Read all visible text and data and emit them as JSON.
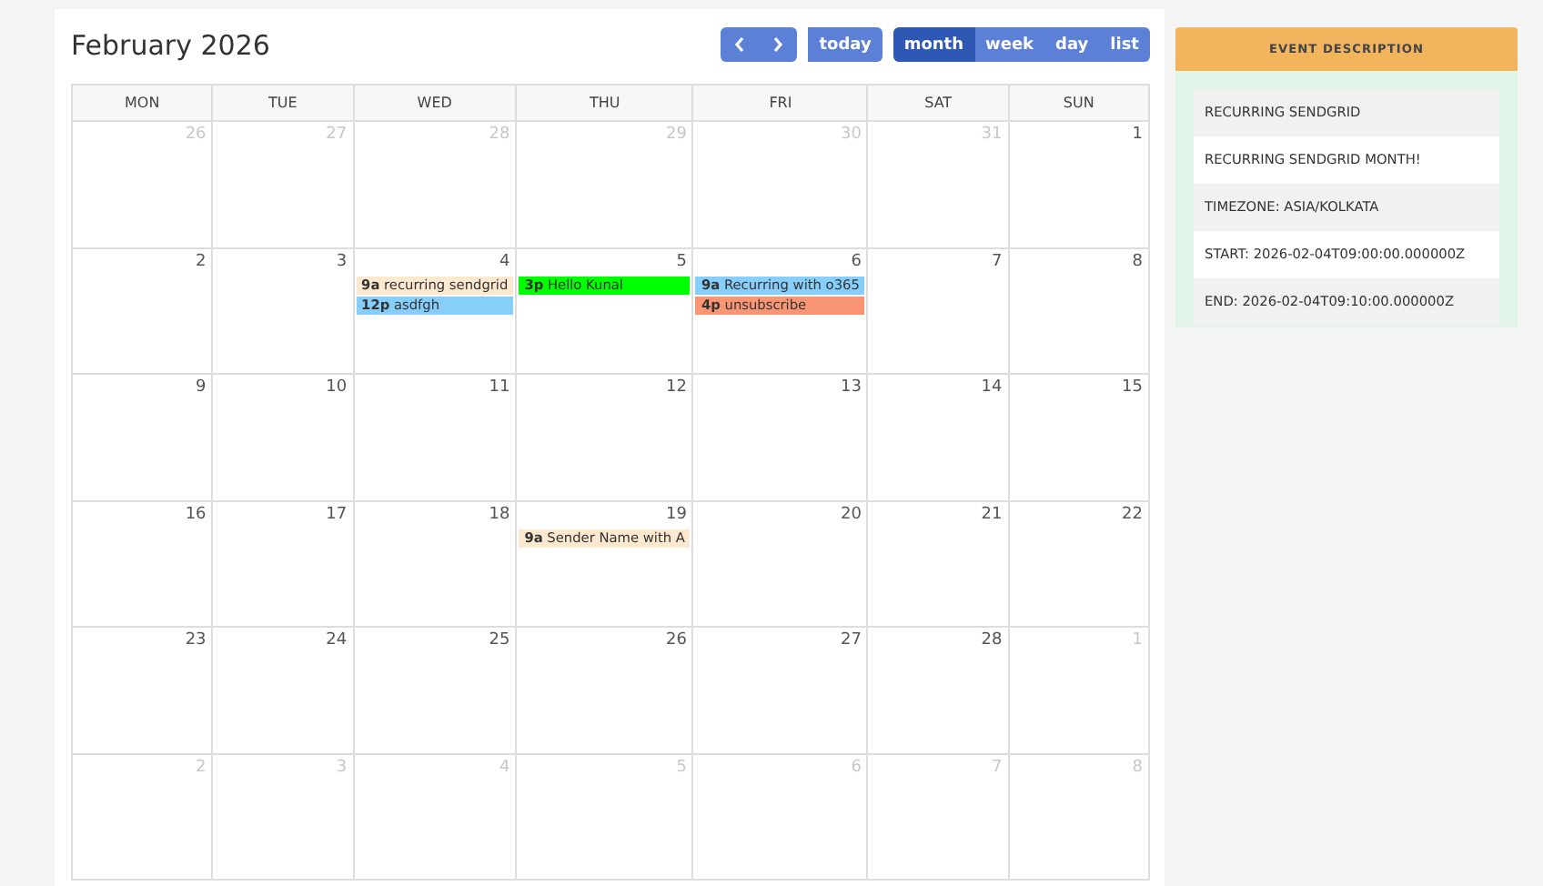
{
  "calendar": {
    "title": "February 2026",
    "nav_buttons": [
      {
        "kind": "prev"
      },
      {
        "kind": "next"
      }
    ],
    "today_button": "today",
    "views": [
      {
        "label": "month",
        "selected": true
      },
      {
        "label": "week",
        "selected": false
      },
      {
        "label": "day",
        "selected": false
      },
      {
        "label": "list",
        "selected": false
      }
    ],
    "weekdays": [
      "MON",
      "TUE",
      "WED",
      "THU",
      "FRI",
      "SAT",
      "SUN"
    ],
    "weeks": [
      [
        {
          "number": "26",
          "other_month": true
        },
        {
          "number": "27",
          "other_month": true
        },
        {
          "number": "28",
          "other_month": true
        },
        {
          "number": "29",
          "other_month": true
        },
        {
          "number": "30",
          "other_month": true
        },
        {
          "number": "31",
          "other_month": true
        },
        {
          "number": "1",
          "other_month": false
        }
      ],
      [
        {
          "number": "2",
          "other_month": false
        },
        {
          "number": "3",
          "other_month": false
        },
        {
          "number": "4",
          "other_month": false,
          "events": [
            {
              "time": "9a",
              "title": "recurring sendgrid",
              "color": "#fde9cf"
            },
            {
              "time": "12p",
              "title": "asdfgh",
              "color": "#87cefa"
            }
          ]
        },
        {
          "number": "5",
          "other_month": false,
          "events": [
            {
              "time": "3p",
              "title": "Hello Kunal",
              "color": "#00ff00"
            }
          ]
        },
        {
          "number": "6",
          "other_month": false,
          "events": [
            {
              "time": "9a",
              "title": "Recurring with o365",
              "color": "#87cefa"
            },
            {
              "time": "4p",
              "title": "unsubscribe",
              "color": "#fa9673"
            }
          ]
        },
        {
          "number": "7",
          "other_month": false
        },
        {
          "number": "8",
          "other_month": false
        }
      ],
      [
        {
          "number": "9",
          "other_month": false
        },
        {
          "number": "10",
          "other_month": false
        },
        {
          "number": "11",
          "other_month": false
        },
        {
          "number": "12",
          "other_month": false
        },
        {
          "number": "13",
          "other_month": false
        },
        {
          "number": "14",
          "other_month": false
        },
        {
          "number": "15",
          "other_month": false
        }
      ],
      [
        {
          "number": "16",
          "other_month": false
        },
        {
          "number": "17",
          "other_month": false
        },
        {
          "number": "18",
          "other_month": false
        },
        {
          "number": "19",
          "other_month": false,
          "events": [
            {
              "time": "9a",
              "title": "Sender Name with A",
              "color": "#fde9cf"
            }
          ]
        },
        {
          "number": "20",
          "other_month": false
        },
        {
          "number": "21",
          "other_month": false
        },
        {
          "number": "22",
          "other_month": false
        }
      ],
      [
        {
          "number": "23",
          "other_month": false
        },
        {
          "number": "24",
          "other_month": false
        },
        {
          "number": "25",
          "other_month": false
        },
        {
          "number": "26",
          "other_month": false
        },
        {
          "number": "27",
          "other_month": false
        },
        {
          "number": "28",
          "other_month": false
        },
        {
          "number": "1",
          "other_month": true
        }
      ],
      [
        {
          "number": "2",
          "other_month": true
        },
        {
          "number": "3",
          "other_month": true
        },
        {
          "number": "4",
          "other_month": true
        },
        {
          "number": "5",
          "other_month": true
        },
        {
          "number": "6",
          "other_month": true
        },
        {
          "number": "7",
          "other_month": true
        },
        {
          "number": "8",
          "other_month": true
        }
      ]
    ]
  },
  "event_description": {
    "heading": "EVENT DESCRIPTION",
    "lines": [
      "RECURRING SENDGRID",
      "RECURRING SENDGRID MONTH!",
      "TIMEZONE: ASIA/KOLKATA",
      "START: 2026-02-04T09:00:00.000000Z",
      "END: 2026-02-04T09:10:00.000000Z"
    ]
  }
}
